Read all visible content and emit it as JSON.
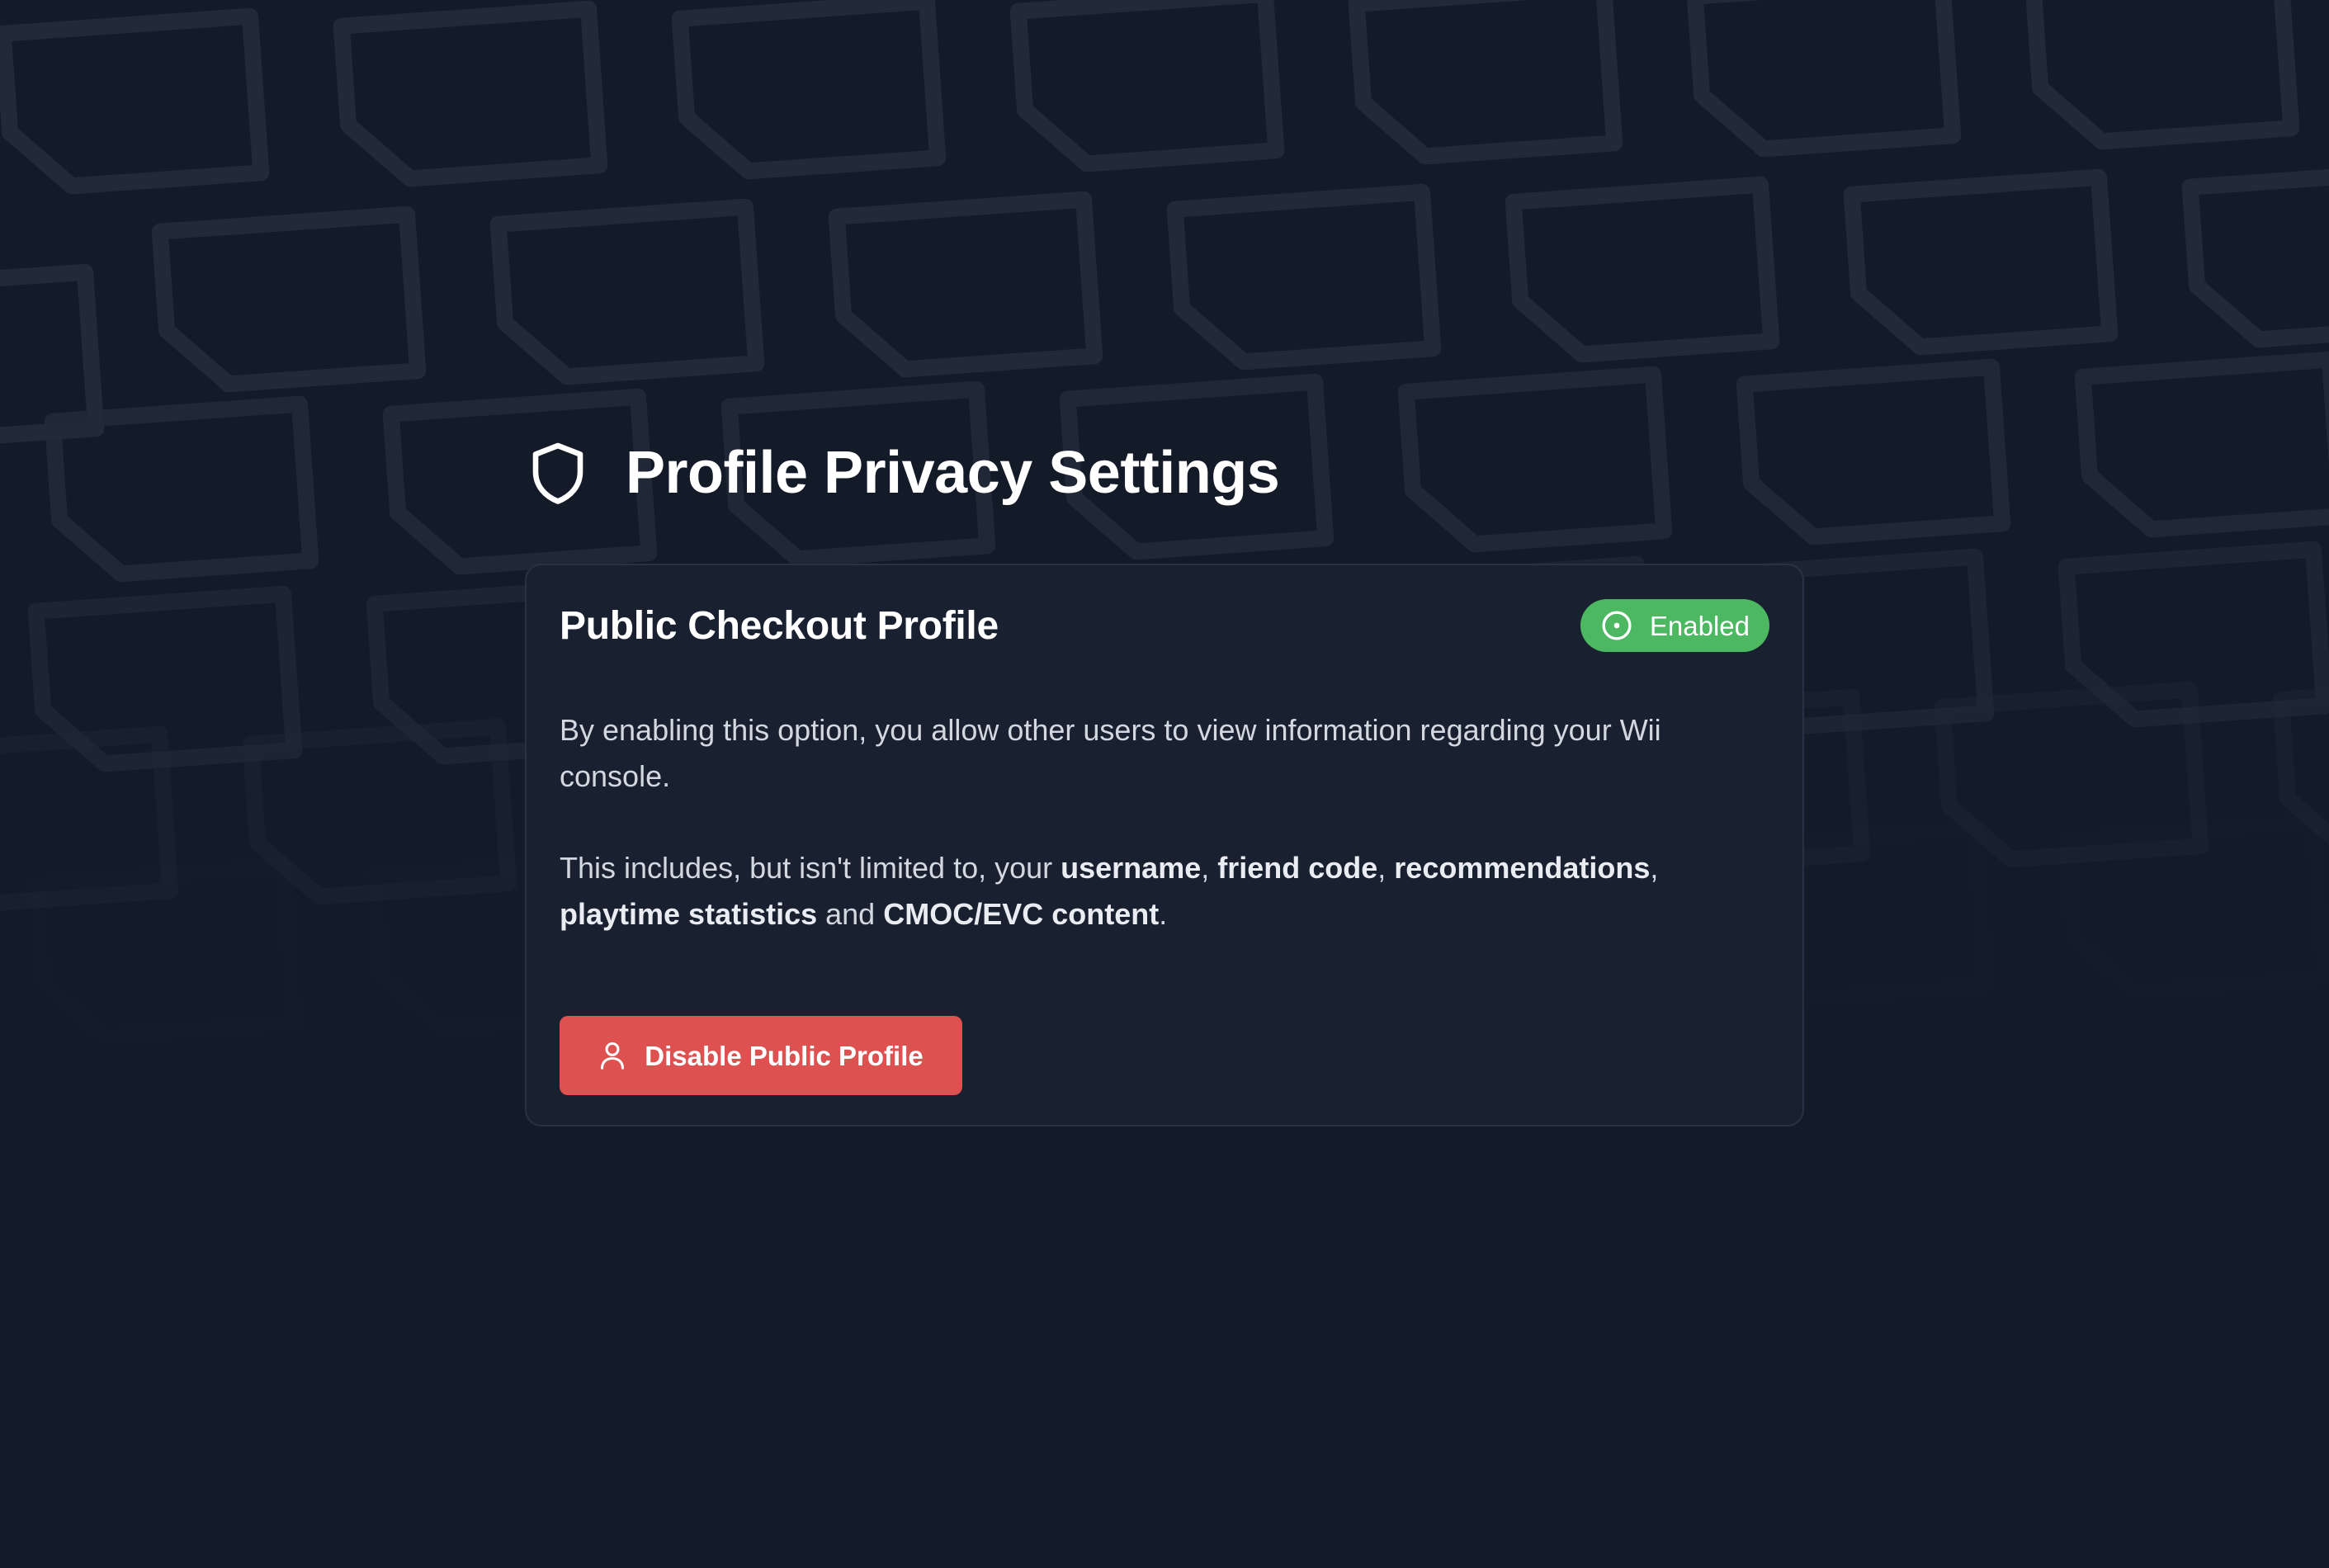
{
  "page": {
    "title": "Profile Privacy Settings",
    "title_icon": "shield-icon"
  },
  "card": {
    "title": "Public Checkout Profile",
    "status": {
      "label": "Enabled",
      "icon": "circle-dot-icon",
      "color": "#4cb862"
    },
    "description": "By enabling this option, you allow other users to view information regarding your Wii console.",
    "includes": {
      "prefix": "This includes, but isn't limited to, your ",
      "items": [
        "username",
        "friend code",
        "recommendations",
        "playtime statistics",
        "CMOC/EVC content"
      ],
      "sep1": ", ",
      "sep2": ", ",
      "sep3": ",",
      "sep4": " and ",
      "suffix": "."
    },
    "button": {
      "label": "Disable Public Profile",
      "icon": "user-icon",
      "color": "#dd5250"
    }
  },
  "colors": {
    "background": "#131a28",
    "card": "#192131"
  }
}
